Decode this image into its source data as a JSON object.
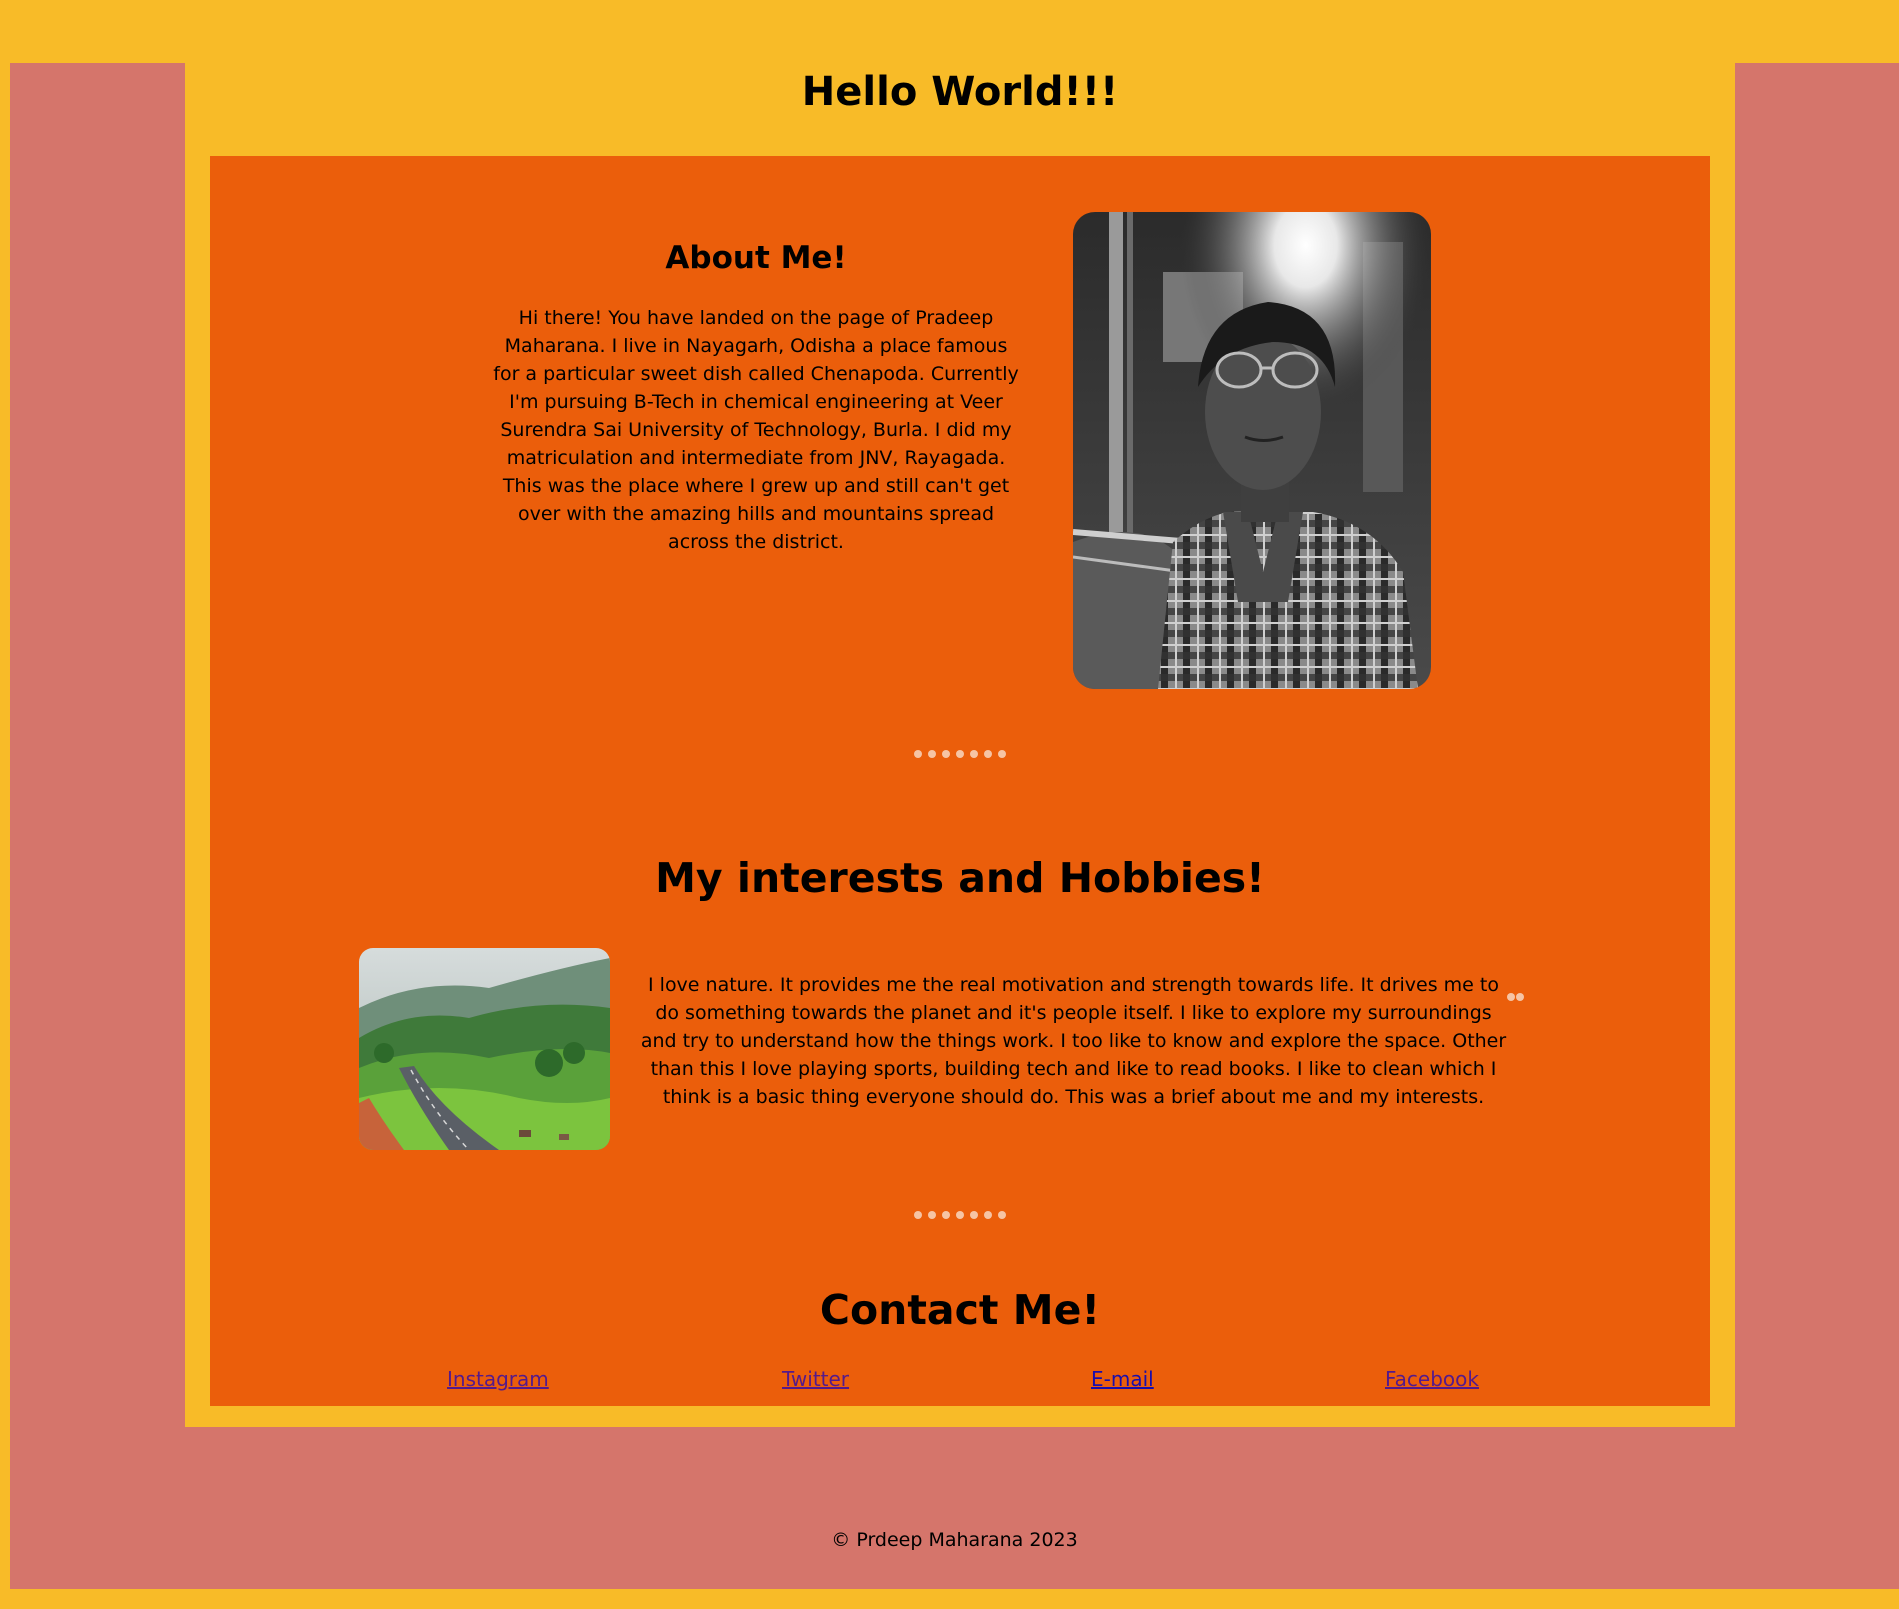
{
  "header": {
    "title": "Hello World!!!"
  },
  "about": {
    "heading": "About Me!",
    "text": "Hi there! You have landed on the page of Pradeep Maharana. I live in Nayagarh, Odisha a place famous for a particular sweet dish called Chenapoda. Currently I'm pursuing B-Tech in chemical engineering at Veer Surendra Sai University of Technology, Burla. I did my matriculation and intermediate from JNV, Rayagada. This was the place where I grew up and still can't get over with the amazing hills and mountains spread across the district."
  },
  "hobbies": {
    "heading": "My interests and Hobbies!",
    "text": "I love nature. It provides me the real motivation and strength towards life. It drives me to do something towards the planet and it's people itself. I like to explore my surroundings and try to understand how the things work. I too like to know and explore the space. Other than this I love playing sports, building tech and like to read books. I like to clean which I think is a basic thing everyone should do. This was a brief about me and my interests."
  },
  "contact": {
    "heading": "Contact Me!",
    "links": [
      {
        "label": "Instagram"
      },
      {
        "label": "Twitter"
      },
      {
        "label": "E-mail"
      },
      {
        "label": "Facebook"
      }
    ]
  },
  "footer": {
    "text": "© Prdeep Maharana 2023"
  },
  "colors": {
    "background_yellow": "#f8bb28",
    "frame_pink": "#d5756b",
    "content_orange": "#eb5e0b",
    "divider_dots": "#f6c4a4",
    "link_visited": "#551a8b",
    "link_unvisited": "#1a0dab"
  }
}
